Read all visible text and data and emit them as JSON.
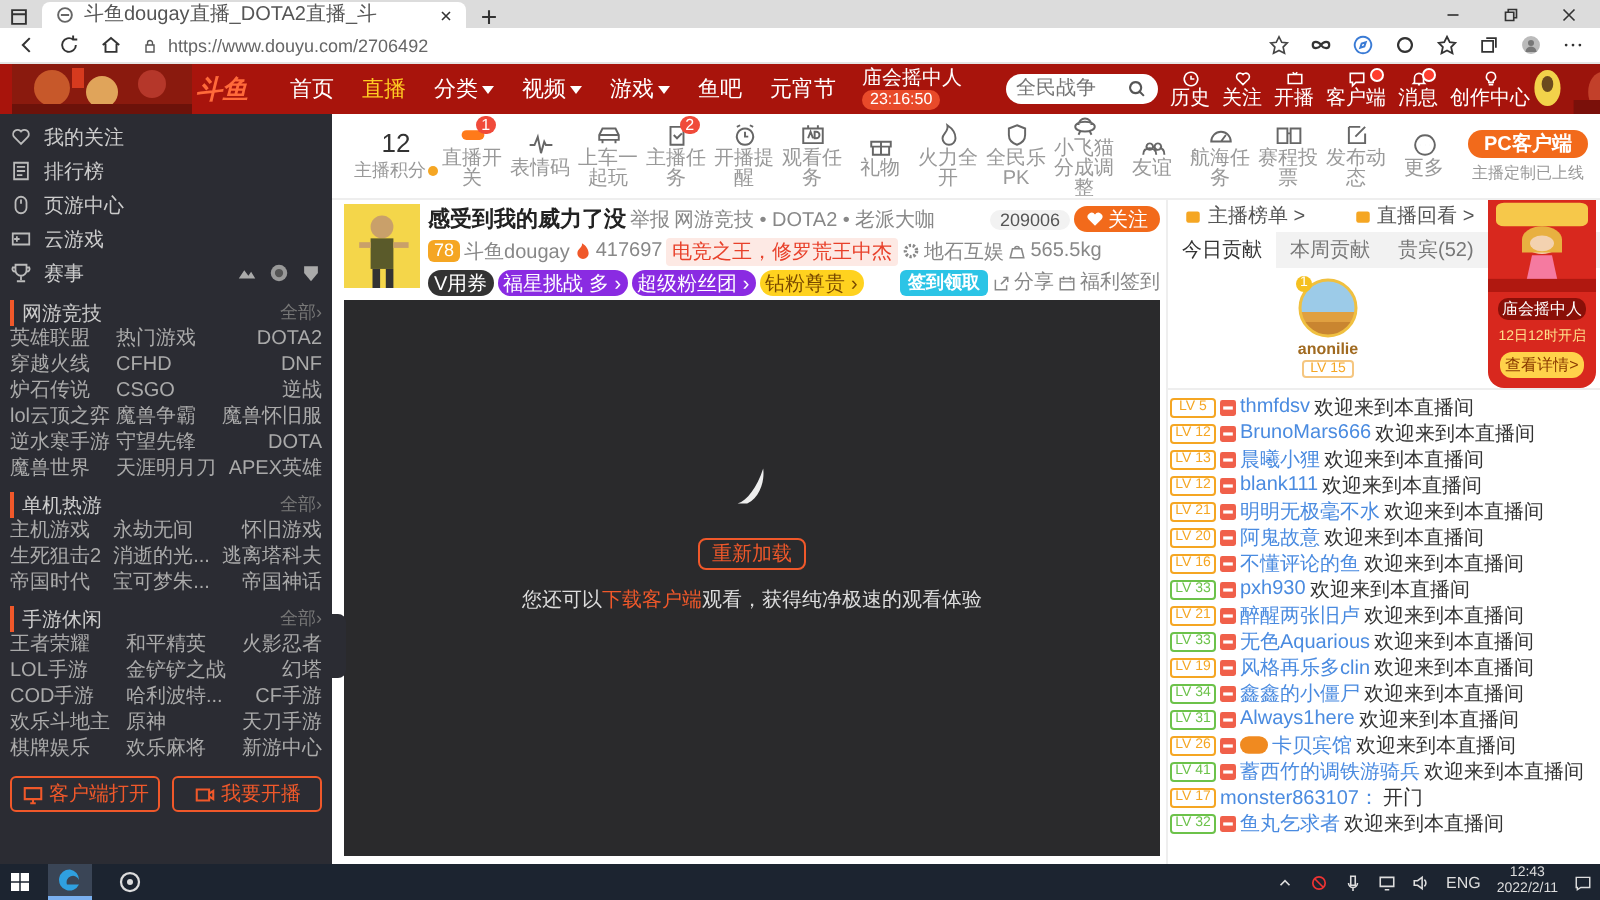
{
  "browser": {
    "tab_title": "斗鱼dougay直播_DOTA2直播_斗",
    "url": "https://www.douyu.com/2706492"
  },
  "site_nav": {
    "logo": "斗鱼",
    "items": [
      {
        "label": "首页",
        "selected": false,
        "dropdown": false
      },
      {
        "label": "直播",
        "selected": true,
        "dropdown": false
      },
      {
        "label": "分类",
        "selected": false,
        "dropdown": true
      },
      {
        "label": "视频",
        "selected": false,
        "dropdown": true
      },
      {
        "label": "游戏",
        "selected": false,
        "dropdown": true
      },
      {
        "label": "鱼吧",
        "selected": false,
        "dropdown": false
      },
      {
        "label": "元宵节",
        "selected": false,
        "dropdown": false
      }
    ],
    "event": {
      "title": "庙会摇中人",
      "countdown": "23:16:50"
    },
    "search": {
      "placeholder": "全民战争"
    },
    "menu": [
      {
        "label": "历史",
        "dot": false
      },
      {
        "label": "关注",
        "dot": false
      },
      {
        "label": "开播",
        "dot": false
      },
      {
        "label": "客户端",
        "dot": true
      },
      {
        "label": "消息",
        "dot": true
      },
      {
        "label": "创作中心",
        "dot": false
      }
    ]
  },
  "toolbar": {
    "points": {
      "value": "12",
      "label": "主播积分"
    },
    "items": [
      {
        "label": "直播开关",
        "badge": "1"
      },
      {
        "label": "表情码"
      },
      {
        "label": "上车一起玩"
      },
      {
        "label": "主播任务",
        "badge": "2"
      },
      {
        "label": "开播提醒"
      },
      {
        "label": "观看任务"
      },
      {
        "label": "礼物"
      },
      {
        "label": "火力全开"
      },
      {
        "label": "全民乐PK"
      },
      {
        "label": "小飞猫分成调整"
      },
      {
        "label": "友谊"
      },
      {
        "label": "航海任务"
      },
      {
        "label": "赛程投票"
      },
      {
        "label": "发布动态"
      },
      {
        "label": "更多"
      }
    ],
    "pc_client": {
      "button": "PC客户端",
      "note": "主播定制已上线"
    }
  },
  "sidebar": {
    "links": [
      "我的关注",
      "排行榜",
      "页游中心",
      "云游戏",
      "赛事"
    ],
    "sections": [
      {
        "title": "网游竞技",
        "more": "全部›",
        "items": [
          "英雄联盟",
          "热门游戏",
          "DOTA2",
          "穿越火线",
          "CFHD",
          "DNF",
          "炉石传说",
          "CSGO",
          "逆战",
          "lol云顶之弈",
          "魔兽争霸",
          "魔兽怀旧服",
          "逆水寒手游",
          "守望先锋",
          "DOTA",
          "魔兽世界",
          "天涯明月刀",
          "APEX英雄"
        ]
      },
      {
        "title": "单机热游",
        "more": "全部›",
        "items": [
          "主机游戏",
          "永劫无间",
          "怀旧游戏",
          "生死狙击2",
          "消逝的光...",
          "逃离塔科夫",
          "帝国时代",
          "宝可梦朱...",
          "帝国神话"
        ]
      },
      {
        "title": "手游休闲",
        "more": "全部›",
        "items": [
          "王者荣耀",
          "和平精英",
          "火影忍者",
          "LOL手游",
          "金铲铲之战",
          "幻塔",
          "COD手游",
          "哈利波特...",
          "CF手游",
          "欢乐斗地主",
          "原神",
          "天刀手游",
          "棋牌娱乐",
          "欢乐麻将",
          "新游中心"
        ]
      }
    ],
    "buttons": [
      "客户端打开",
      "我要开播"
    ]
  },
  "stream": {
    "title": "感受到我的威力了没",
    "report": "举报",
    "category": "网游竞技 • DOTA2 • 老派大咖",
    "level": "78",
    "anchor": "斗鱼dougay",
    "hot": "417697",
    "tag": "电竞之王，修罗荒王中杰",
    "guild": "地石互娱",
    "weight": "565.5kg",
    "pills": [
      {
        "label": "V用券",
        "kind": "dark"
      },
      {
        "label": "福星挑战 多 ›",
        "kind": "purple"
      },
      {
        "label": "超级粉丝团 ›",
        "kind": "purple"
      },
      {
        "label": "钻粉尊贵 ›",
        "kind": "gold"
      }
    ],
    "followers": "209006",
    "follow": "关注",
    "sign_badge": "签到领取",
    "share": "分享",
    "welfare": "福利签到"
  },
  "video": {
    "reload": "重新加载",
    "hint_before": "您还可以",
    "hint_link": "下载客户端",
    "hint_after": "观看，获得纯净极速的观看体验"
  },
  "chat": {
    "links": [
      "主播榜单 >",
      "直播回看 >"
    ],
    "tabs": [
      {
        "label": "今日贡献",
        "selected": true
      },
      {
        "label": "本周贡献",
        "selected": false
      },
      {
        "label": "贵宾(52)",
        "selected": false
      }
    ],
    "top_fan": {
      "rank": "1",
      "name": "anonilie",
      "level": "LV 15"
    },
    "messages": [
      {
        "level": "LV 5",
        "color": "#f5a623",
        "medal": true,
        "noble": false,
        "user": "thmfdsv",
        "text": "欢迎来到本直播间"
      },
      {
        "level": "LV 12",
        "color": "#f5a623",
        "medal": true,
        "noble": false,
        "user": "BrunoMars666",
        "text": "欢迎来到本直播间"
      },
      {
        "level": "LV 13",
        "color": "#f5a623",
        "medal": true,
        "noble": false,
        "user": "晨曦小狸",
        "text": "欢迎来到本直播间"
      },
      {
        "level": "LV 12",
        "color": "#f5a623",
        "medal": true,
        "noble": false,
        "user": "blank111",
        "text": "欢迎来到本直播间"
      },
      {
        "level": "LV 21",
        "color": "#f5a623",
        "medal": true,
        "noble": false,
        "user": "明明无极毫不水",
        "text": "欢迎来到本直播间"
      },
      {
        "level": "LV 20",
        "color": "#f5a623",
        "medal": true,
        "noble": false,
        "user": "阿鬼故意",
        "text": "欢迎来到本直播间"
      },
      {
        "level": "LV 16",
        "color": "#f5a623",
        "medal": true,
        "noble": false,
        "user": "不懂评论的鱼",
        "text": "欢迎来到本直播间"
      },
      {
        "level": "LV 33",
        "color": "#6cc24a",
        "medal": true,
        "noble": false,
        "user": "pxh930",
        "text": "欢迎来到本直播间"
      },
      {
        "level": "LV 21",
        "color": "#f5a623",
        "medal": true,
        "noble": false,
        "user": "醉醒两张旧卢",
        "text": "欢迎来到本直播间"
      },
      {
        "level": "LV 33",
        "color": "#6cc24a",
        "medal": true,
        "noble": false,
        "user": "无色Aquarious",
        "text": "欢迎来到本直播间"
      },
      {
        "level": "LV 19",
        "color": "#f5a623",
        "medal": true,
        "noble": false,
        "user": "风格再乐多clin",
        "text": "欢迎来到本直播间"
      },
      {
        "level": "LV 34",
        "color": "#6cc24a",
        "medal": true,
        "noble": false,
        "user": "鑫鑫的小僵尸",
        "text": "欢迎来到本直播间"
      },
      {
        "level": "LV 31",
        "color": "#6cc24a",
        "medal": true,
        "noble": false,
        "user": "Always1here",
        "text": "欢迎来到本直播间"
      },
      {
        "level": "LV 26",
        "color": "#f5a623",
        "medal": true,
        "noble": true,
        "user": "卡贝宾馆",
        "text": "欢迎来到本直播间"
      },
      {
        "level": "LV 41",
        "color": "#6cc24a",
        "medal": true,
        "noble": false,
        "user": "蓄西竹的调铁游骑兵",
        "text": "欢迎来到本直播间"
      },
      {
        "level": "LV 17",
        "color": "#f5a623",
        "medal": false,
        "noble": false,
        "user": "monster863107：",
        "text": "开门"
      },
      {
        "level": "LV 32",
        "color": "#6cc24a",
        "medal": true,
        "noble": false,
        "user": "鱼丸乞求者",
        "text": "欢迎来到本直播间"
      }
    ]
  },
  "ad": {
    "title": "庙会摇中人",
    "time": "12日12时开启",
    "button": "查看详情>"
  },
  "taskbar": {
    "lang": "ENG",
    "time": "12:43",
    "date": "2022/2/11"
  }
}
